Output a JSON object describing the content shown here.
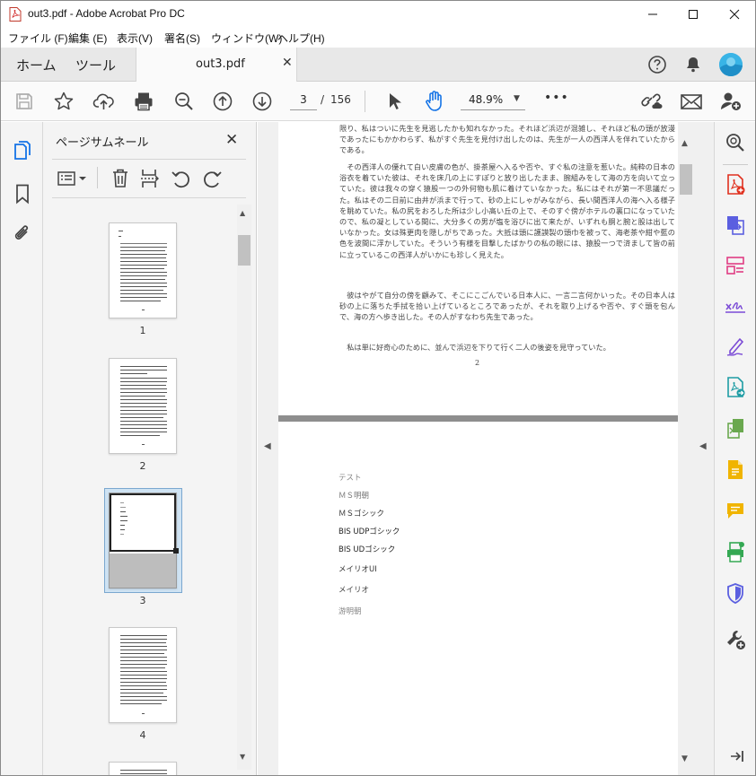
{
  "window": {
    "title": "out3.pdf - Adobe Acrobat Pro DC",
    "controls": {
      "minimize": "—",
      "maximize": "☐",
      "close": "✕"
    }
  },
  "menu": [
    "ファイル (F)",
    "編集 (E)",
    "表示(V)",
    "署名(S)",
    "ウィンドウ(W)",
    "ヘルプ(H)"
  ],
  "tabs": {
    "home": "ホーム",
    "tools": "ツール",
    "document": "out3.pdf",
    "close": "✕"
  },
  "toolbar": {
    "page_current": "3",
    "page_separator": "/",
    "page_total": "156",
    "zoom": "48.9%",
    "more": "•••"
  },
  "thumbnails": {
    "title": "ページサムネール",
    "close": "✕",
    "pages": [
      "1",
      "2",
      "3",
      "4"
    ],
    "selected": "3"
  },
  "document": {
    "page2_paragraphs": [
      "限り、私はついに先生を見逃したかも知れなかった。それほど浜辺が混雑し、それほど私の頭が放漫であったにもかかわらず、私がすぐ先生を見付け出したのは、先生が一人の西洋人を伴れていたからである。",
      "その西洋人の優れて白い皮膚の色が、掛茶屋へ入るや否や、すぐ私の注意を惹いた。純粋の日本の浴衣を着ていた彼は、それを床几の上にすぽりと放り出したまま、腕組みをして海の方を向いて立っていた。彼は我々の穿く猿股一つの外何物も肌に着けていなかった。私にはそれが第一不思議だった。私はその二日前に由井が浜まで行って、砂の上にしゃがみながら、長い間西洋人の海へ入る様子を眺めていた。私の尻をおろした所は少し小高い丘の上で、そのすぐ傍がホテルの裏口になっていたので、私の凝としている間に、大分多くの男が塩を浴びに出て来たが、いずれも胴と腕と股は出していなかった。女は殊更肉を隠しがちであった。大抵は頭に護謨製の頭巾を被って、海老茶や紺や藍の色を波間に浮かしていた。そういう有様を目撃したばかりの私の眼には、猿股一つで済まして皆の前に立っているこの西洋人がいかにも珍しく見えた。",
      "彼はやがて自分の傍を顧みて、そこにこごんでいる日本人に、一言二言何かいった。その日本人は砂の上に落ちた手拭を拾い上げているところであったが、それを取り上げるや否や、すぐ頭を包んで、海の方へ歩き出した。その人がすなわち先生であった。",
      "私は単に好奇心のために、並んで浜辺を下りて行く二人の後姿を見守っていた。"
    ],
    "page2_number": "2",
    "page3_samples": [
      "テスト",
      "ＭＳ明朝",
      "ＭＳゴシック",
      "BIS UDPゴシック",
      "BIS UDゴシック",
      "メイリオUI",
      "メイリオ",
      "游明朝"
    ]
  }
}
